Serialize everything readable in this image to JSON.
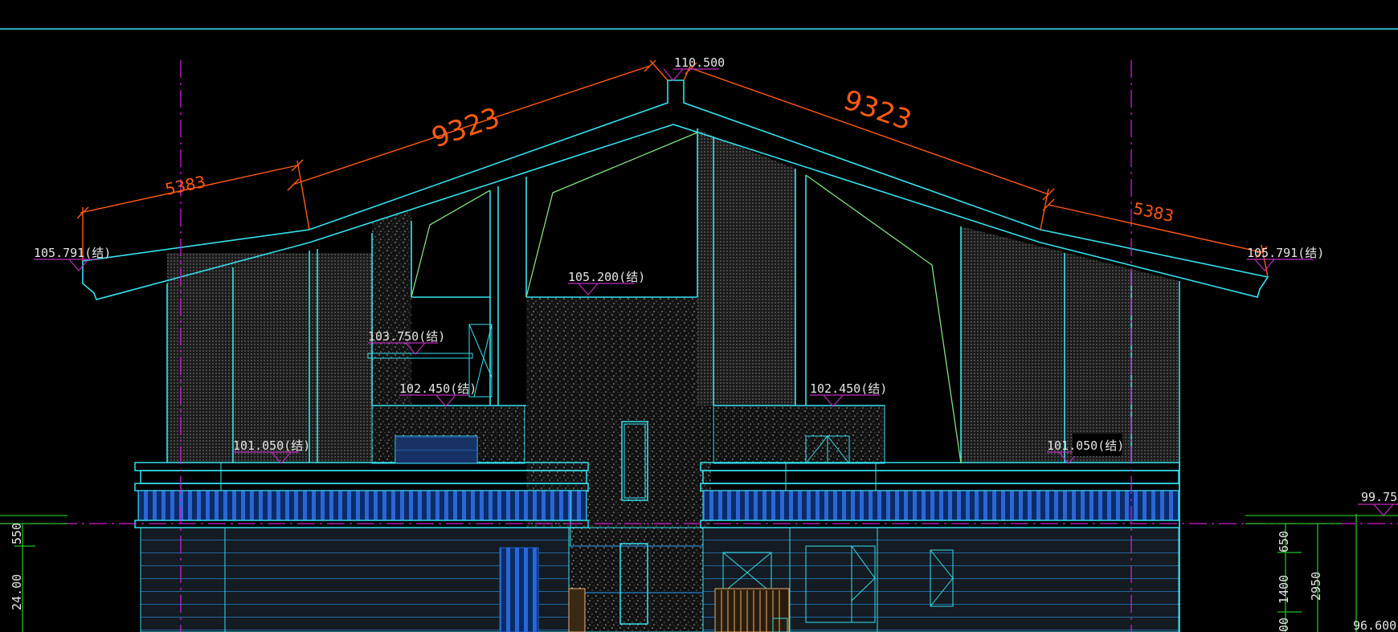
{
  "drawing": {
    "colors": {
      "background": "#000000",
      "outline": "#35e1ee",
      "dimension": "#ff5a14",
      "axis": "#d21ad6",
      "elevation_mark": "#c02cc0",
      "hatch": "#555555",
      "structure": "#7fe07f",
      "blue_panel": "#1e64d8",
      "wood": "#e8b070",
      "text": "#e6e6e6",
      "ground_line": "#22c022"
    },
    "dimensions": {
      "left_eave_dim": "5383",
      "left_slope_dim": "9323",
      "right_slope_dim": "9323",
      "right_eave_dim": "5383"
    },
    "elevation_labels": {
      "ridge": "110.500",
      "eave_left": "105.791(结)",
      "eave_right": "105.791(结)",
      "mid_high": "105.200(结)",
      "left_upper": "103.750(结)",
      "left_mid": "102.450(结)",
      "right_mid": "102.450(结)",
      "left_low": "101.050(结)",
      "right_low": "101.050(结)",
      "right_edge_top": "99.75",
      "right_edge_bottom": "96.600"
    },
    "side_dims": {
      "left_a": "550",
      "left_b": "24.00",
      "right_a": "650",
      "right_b": "1400",
      "right_c": "2950",
      "right_d": "00"
    }
  }
}
